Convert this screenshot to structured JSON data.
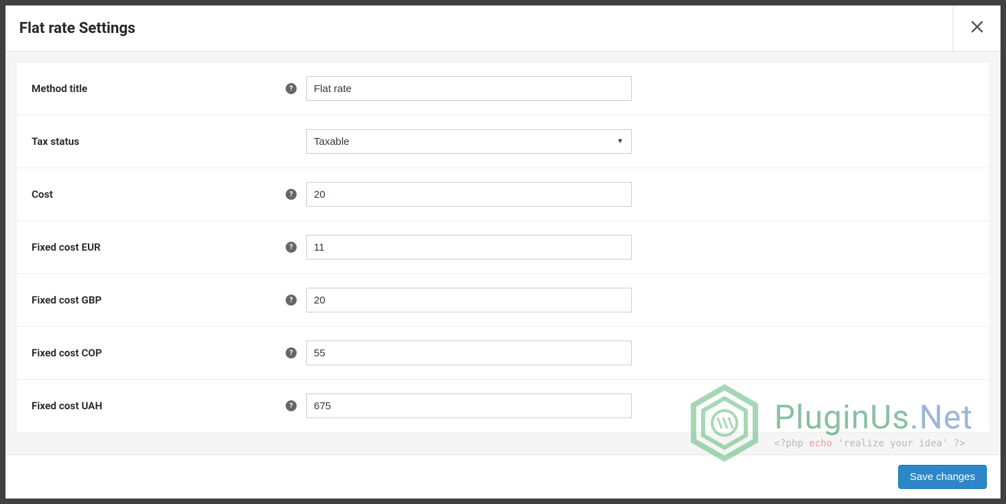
{
  "modal": {
    "title": "Flat rate Settings",
    "save_label": "Save changes"
  },
  "fields": {
    "method_title": {
      "label": "Method title",
      "value": "Flat rate"
    },
    "tax_status": {
      "label": "Tax status",
      "value": "Taxable"
    },
    "cost": {
      "label": "Cost",
      "value": "20"
    },
    "fixed_eur": {
      "label": "Fixed cost EUR",
      "value": "11"
    },
    "fixed_gbp": {
      "label": "Fixed cost GBP",
      "value": "20"
    },
    "fixed_cop": {
      "label": "Fixed cost COP",
      "value": "55"
    },
    "fixed_uah": {
      "label": "Fixed cost UAH",
      "value": "675"
    }
  },
  "watermark": {
    "brand_plug": "PluginUs",
    "brand_dot": ".",
    "brand_net": "Net",
    "code_open": "<?php ",
    "code_echo": "echo",
    "code_str": " 'realize your idea' ",
    "code_close": "?>"
  }
}
